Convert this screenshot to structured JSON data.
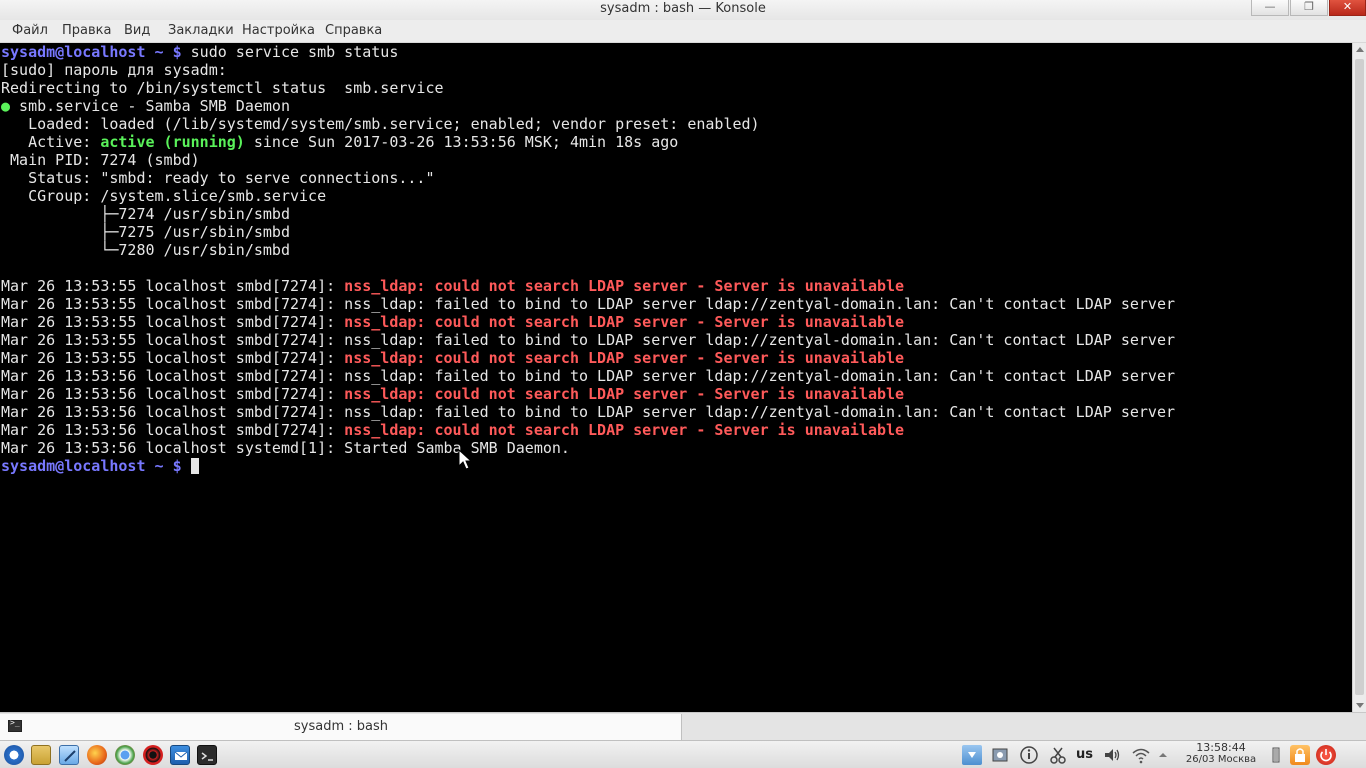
{
  "window": {
    "title": "sysadm : bash — Konsole",
    "buttons": {
      "minimize": "—",
      "maximize": "❐",
      "close": "✕"
    }
  },
  "menu": [
    "Файл",
    "Правка",
    "Вид",
    "Закладки",
    "Настройка",
    "Справка"
  ],
  "terminal": {
    "prompt": "sysadm@localhost ~ $",
    "command": "sudo service smb status",
    "lines": {
      "sudo_pw": "[sudo] пароль для sysadm:",
      "redirect": "Redirecting to /bin/systemctl status  smb.service",
      "bullet": "●",
      "unit": " smb.service - Samba SMB Daemon",
      "loaded": "   Loaded: loaded (/lib/systemd/system/smb.service; enabled; vendor preset: enabled)",
      "active_label": "   Active: ",
      "active_state": "active (running)",
      "active_since": " since Sun 2017-03-26 13:53:56 MSK; 4min 18s ago",
      "main_pid": " Main PID: 7274 (smbd)",
      "status": "   Status: \"smbd: ready to serve connections...\"",
      "cgroup": "   CGroup: /system.slice/smb.service",
      "proc1": "           ├─7274 /usr/sbin/smbd",
      "proc2": "           ├─7275 /usr/sbin/smbd",
      "proc3": "           └─7280 /usr/sbin/smbd"
    },
    "log": [
      {
        "prefix": "Mar 26 13:53:55 localhost smbd[7274]: ",
        "msg": "nss_ldap: could not search LDAP server - Server is unavailable",
        "error": true
      },
      {
        "prefix": "Mar 26 13:53:55 localhost smbd[7274]: ",
        "msg": "nss_ldap: failed to bind to LDAP server ldap://zentyal-domain.lan: Can't contact LDAP server",
        "error": false
      },
      {
        "prefix": "Mar 26 13:53:55 localhost smbd[7274]: ",
        "msg": "nss_ldap: could not search LDAP server - Server is unavailable",
        "error": true
      },
      {
        "prefix": "Mar 26 13:53:55 localhost smbd[7274]: ",
        "msg": "nss_ldap: failed to bind to LDAP server ldap://zentyal-domain.lan: Can't contact LDAP server",
        "error": false
      },
      {
        "prefix": "Mar 26 13:53:55 localhost smbd[7274]: ",
        "msg": "nss_ldap: could not search LDAP server - Server is unavailable",
        "error": true
      },
      {
        "prefix": "Mar 26 13:53:56 localhost smbd[7274]: ",
        "msg": "nss_ldap: failed to bind to LDAP server ldap://zentyal-domain.lan: Can't contact LDAP server",
        "error": false
      },
      {
        "prefix": "Mar 26 13:53:56 localhost smbd[7274]: ",
        "msg": "nss_ldap: could not search LDAP server - Server is unavailable",
        "error": true
      },
      {
        "prefix": "Mar 26 13:53:56 localhost smbd[7274]: ",
        "msg": "nss_ldap: failed to bind to LDAP server ldap://zentyal-domain.lan: Can't contact LDAP server",
        "error": false
      },
      {
        "prefix": "Mar 26 13:53:56 localhost smbd[7274]: ",
        "msg": "nss_ldap: could not search LDAP server - Server is unavailable",
        "error": true
      },
      {
        "prefix": "Mar 26 13:53:56 localhost systemd[1]: ",
        "msg": "Started Samba SMB Daemon.",
        "error": false
      }
    ]
  },
  "tab": {
    "label": "sysadm : bash",
    "icon": "terminal-icon"
  },
  "taskbar": {
    "launchers": [
      "start-menu-icon",
      "file-manager-icon",
      "text-editor-icon",
      "firefox-icon",
      "chromium-icon",
      "screen-recorder-icon",
      "thunderbird-icon",
      "konsole-icon"
    ],
    "tray_icons": [
      "download-icon",
      "system-settings-icon",
      "info-icon",
      "clipboard-scissors-icon",
      "volume-icon",
      "wifi-icon",
      "tray-expand-icon",
      "battery-icon",
      "lock-icon",
      "power-icon"
    ],
    "keyboard_layout": "us",
    "clock_time": "13:58:44",
    "clock_date": "26/03 Москва"
  },
  "colors": {
    "prompt": "#7878ff",
    "active_green": "#5af25a",
    "error_red": "#ff5a5a",
    "terminal_bg": "#000000",
    "terminal_fg": "#e6e6e6"
  }
}
